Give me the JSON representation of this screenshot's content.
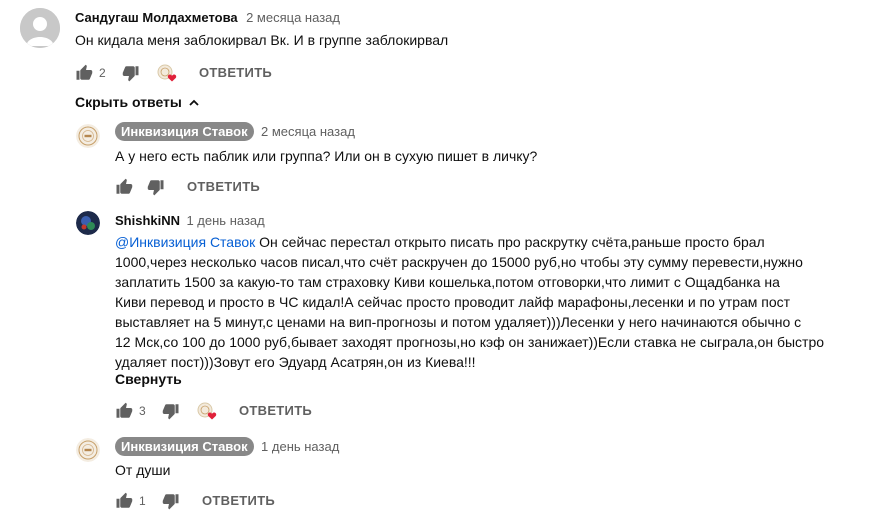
{
  "comment1": {
    "author": "Сандугаш Молдахметова",
    "time": "2 месяца назад",
    "text": "Он кидала меня заблокирвал Вк. И в группе заблокирвал",
    "likes": "2",
    "reply_label": "ОТВЕТИТЬ"
  },
  "hide_replies": {
    "label": "Скрыть ответы"
  },
  "reply1": {
    "author": "Инквизиция Ставок",
    "time": "2 месяца назад",
    "text": "А у него есть паблик или группа? Или он в сухую пишет в личку?",
    "reply_label": "ОТВЕТИТЬ"
  },
  "reply2": {
    "author": "ShishkiNN",
    "time": "1 день назад",
    "mention": "@Инквизиция Ставок",
    "lines": [
      " Он сейчас перестал открыто писать про раскрутку счёта,раньше просто брал",
      "1000,через несколько часов писал,что счёт раскручен до 15000 руб,но чтобы эту сумму перевести,нужно",
      "заплатить 1500 за какую-то там страховку  Киви кошелька,потом отговорки,что лимит с Ощадбанка на",
      "Киви перевод и просто в ЧС кидал!А сейчас просто проводит лайф марафоны,лесенки и по утрам пост",
      "выставляет на 5 минут,с ценами на вип-прогнозы и потом удаляет)))Лесенки у него начинаются обычно с",
      "12 Мск,со 100 до 1000 руб,бывает заходят прогнозы,но кэф он занижает))Если ставка не сыграла,он быстро",
      "удаляет пост)))Зовут его Эдуард Асатрян,он из Киева!!!"
    ],
    "collapse_label": "Свернуть",
    "likes": "3",
    "reply_label": "ОТВЕТИТЬ"
  },
  "reply3": {
    "author": "Инквизиция Ставок",
    "time": "1 день назад",
    "text": "От души",
    "likes": "1",
    "reply_label": "ОТВЕТИТЬ"
  },
  "colors": {
    "link": "#065fd4",
    "heart": "#e0213a",
    "muted": "#606060",
    "chip": "#888888"
  }
}
